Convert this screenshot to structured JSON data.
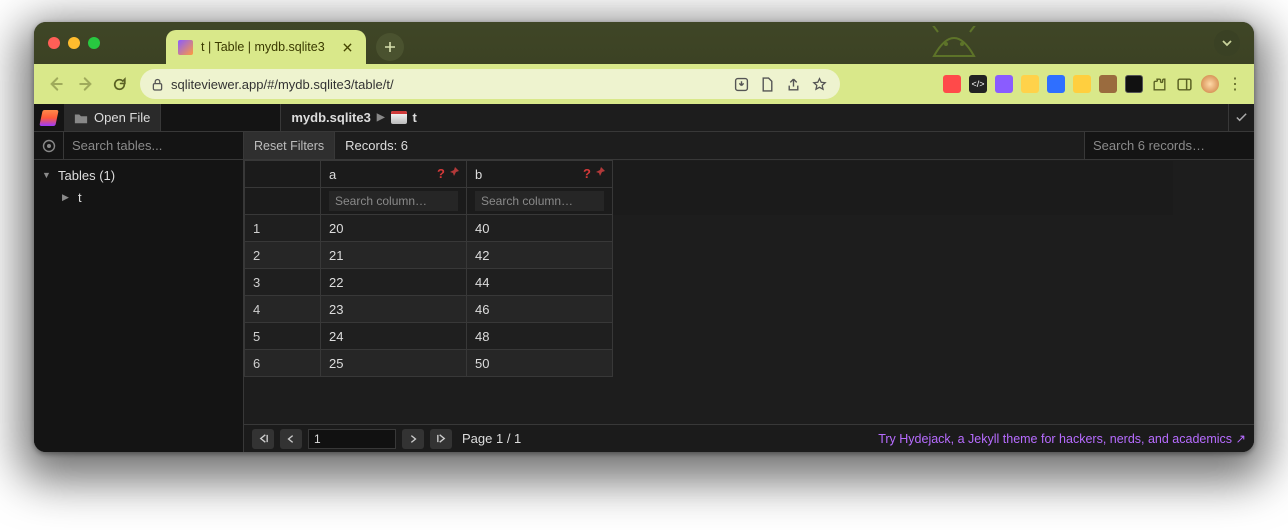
{
  "browser": {
    "tab_title": "t | Table | mydb.sqlite3",
    "url": "sqliteviewer.app/#/mydb.sqlite3/table/t/"
  },
  "header": {
    "open_file_label": "Open File",
    "breadcrumb_db": "mydb.sqlite3",
    "breadcrumb_sep": "▶",
    "breadcrumb_table": "t"
  },
  "toolbar": {
    "search_tables_placeholder": "Search tables...",
    "reset_filters_label": "Reset Filters",
    "records_label": "Records: 6",
    "search_records_placeholder": "Search 6 records…"
  },
  "sidebar": {
    "tables_label": "Tables (1)",
    "items": [
      "t"
    ]
  },
  "grid": {
    "columns": [
      {
        "name": "a",
        "filter_placeholder": "Search column…"
      },
      {
        "name": "b",
        "filter_placeholder": "Search column…"
      }
    ],
    "rows": [
      {
        "n": "1",
        "a": "20",
        "b": "40"
      },
      {
        "n": "2",
        "a": "21",
        "b": "42"
      },
      {
        "n": "3",
        "a": "22",
        "b": "44"
      },
      {
        "n": "4",
        "a": "23",
        "b": "46"
      },
      {
        "n": "5",
        "a": "24",
        "b": "48"
      },
      {
        "n": "6",
        "a": "25",
        "b": "50"
      }
    ]
  },
  "footer": {
    "page_input": "1",
    "page_label": "Page 1 / 1",
    "promo_text": "Try Hydejack, a Jekyll theme for hackers, nerds, and academics ↗"
  }
}
